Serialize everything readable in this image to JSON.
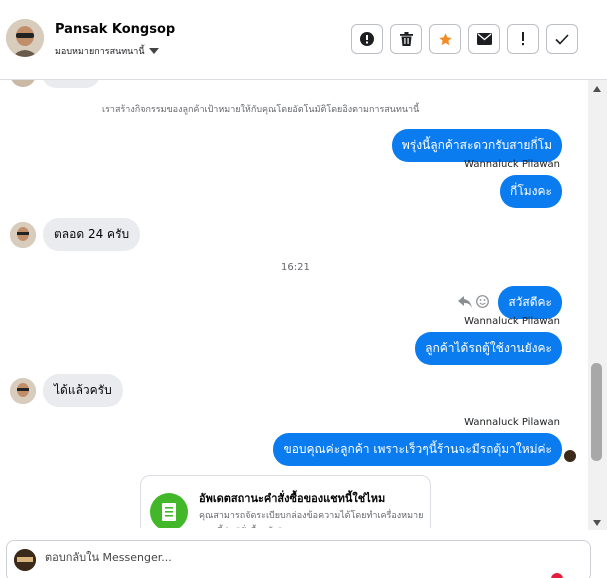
{
  "header": {
    "contact_name": "Pansak Kongsop",
    "assign_label": "มอบหมายการสนทนานี้",
    "actions": [
      {
        "name": "spam-button",
        "icon": "exclamation-circle-icon"
      },
      {
        "name": "delete-button",
        "icon": "trash-icon"
      },
      {
        "name": "star-button",
        "icon": "star-icon"
      },
      {
        "name": "mark-unread-button",
        "icon": "envelope-icon"
      },
      {
        "name": "follow-up-button",
        "icon": "exclamation-icon"
      },
      {
        "name": "done-button",
        "icon": "checkmark-icon"
      }
    ]
  },
  "chat": {
    "system_note": "เราสร้างกิจกรรมของลูกค้าเป้าหมายให้กับคุณโดยอัตโนมัติโดยอิงตามการสนทนานี้",
    "out1": "พรุ่งนี้ลูกค้าสะดวกรับสายกี่โม",
    "sender1": "Wannaluck Pilawan",
    "out2": "กี่โมงคะ",
    "in1": "ตลอด 24 ครับ",
    "time1": "16:21",
    "out3": "สวัสดีคะ",
    "sender2": "Wannaluck Pilawan",
    "out4": "ลูกค้าได้รถตู้ใช้งานยังคะ",
    "in2": "ได้แล้วครับ",
    "sender3": "Wannaluck Pilawan",
    "out5": "ขอบคุณค่ะลูกค้า  เพราะเร็วๆนี้ร้านจะมีรถตุ้มาใหม่ค่ะ",
    "card_title": "อัพเดตสถานะคำสั่งซื้อของแชทนี้ใช่ไหม",
    "card_body": "คุณสามารถจัดระเบียบกล่องข้อความได้โดยทำเครื่องหมายแชทนี้ว่า \"สั่งซื้อแล้ว\""
  },
  "reply": {
    "placeholder": "ตอบกลับใน Messenger..."
  },
  "colors": {
    "accent": "#0b7cf0",
    "incoming_bubble": "#e9ebee",
    "star": "#f28b24",
    "card_icon": "#42b72a"
  }
}
